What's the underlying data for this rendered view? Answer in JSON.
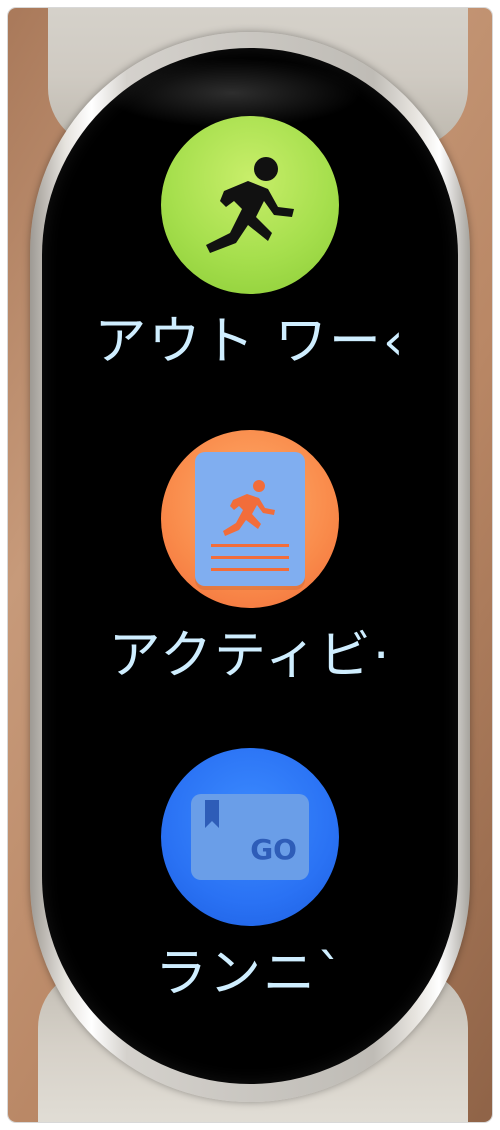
{
  "apps": [
    {
      "label": "アウト ワー‹",
      "icon": "running-figure-icon",
      "color": "#a6df4d"
    },
    {
      "label": "アクティビ·",
      "icon": "activity-record-icon",
      "color": "#f98a4a"
    },
    {
      "label": "ランニ`",
      "icon": "bookmark-go-card-icon",
      "color": "#2a72f4",
      "icon_text": "GO"
    }
  ],
  "colors": {
    "label_text": "#cfeeff",
    "screen_bg": "#000000"
  }
}
